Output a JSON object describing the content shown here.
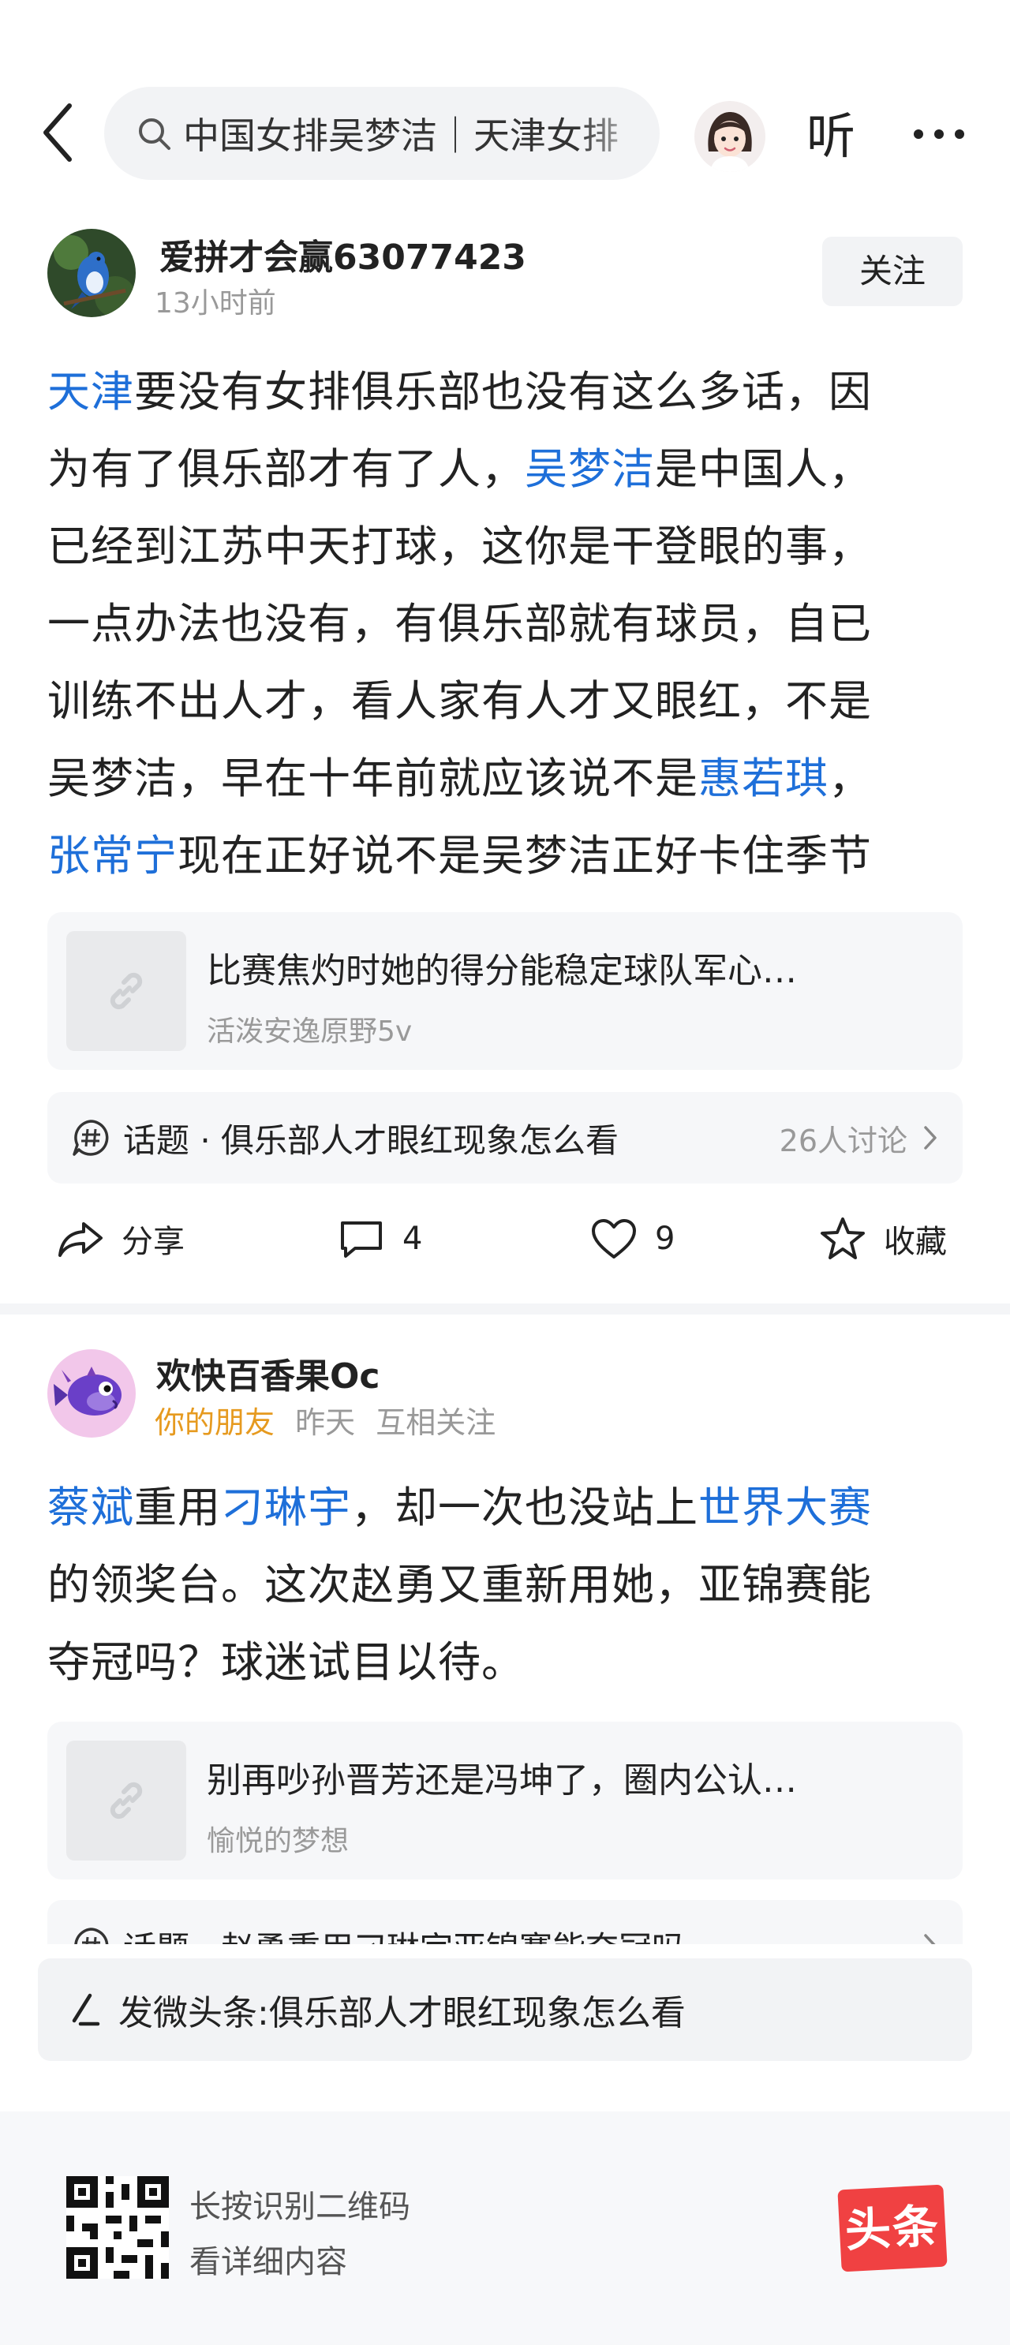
{
  "header": {
    "search_text": "中国女排吴梦洁｜天津女排",
    "listen_label": "听"
  },
  "post1": {
    "author": "爱拼才会赢63077423",
    "time": "13小时前",
    "follow_label": "关注",
    "body_lines": [
      [
        {
          "t": "天津",
          "hl": true
        },
        {
          "t": "要没有女排俱乐部也没有这么多话，因"
        }
      ],
      [
        {
          "t": "为有了俱乐部才有了人，"
        },
        {
          "t": "吴梦洁",
          "hl": true
        },
        {
          "t": "是中国人，"
        }
      ],
      [
        {
          "t": "已经到江苏中天打球，这你是干登眼的事，"
        }
      ],
      [
        {
          "t": "一点办法也没有，有俱乐部就有球员，自已"
        }
      ],
      [
        {
          "t": "训练不出人才，看人家有人才又眼红，不是"
        }
      ],
      [
        {
          "t": "吴梦洁，早在十年前就应该说不是"
        },
        {
          "t": "惠若琪",
          "hl": true
        },
        {
          "t": "，"
        }
      ],
      [
        {
          "t": "张常宁",
          "hl": true
        },
        {
          "t": "现在正好说不是吴梦洁正好卡住季节"
        }
      ]
    ],
    "link_card": {
      "title": "比赛焦灼时她的得分能稳定球队军心…",
      "source": "活泼安逸原野5v"
    },
    "topic": {
      "label": "话题 · 俱乐部人才眼红现象怎么看",
      "count": "26人讨论"
    },
    "actions": {
      "share": "分享",
      "comments": "4",
      "likes": "9",
      "collect": "收藏"
    }
  },
  "post2": {
    "author": "欢快百香果Oc",
    "friend_tag": "你的朋友",
    "time": "昨天",
    "relation": "互相关注",
    "body_lines": [
      [
        {
          "t": "蔡斌",
          "hl": true
        },
        {
          "t": "重用"
        },
        {
          "t": "刁琳宇",
          "hl": true
        },
        {
          "t": "，却一次也没站上"
        },
        {
          "t": "世界大赛",
          "hl": true
        }
      ],
      [
        {
          "t": "的领奖台。这次赵勇又重新用她，亚锦赛能"
        }
      ],
      [
        {
          "t": "夺冠吗？球迷试目以待。"
        }
      ]
    ],
    "link_card": {
      "title": "别再吵孙晋芳还是冯坤了，圈内公认…",
      "source": "愉悦的梦想"
    },
    "topic": {
      "label": "话题 · 赵勇重用刁琳宇亚锦赛能夺冠吗"
    }
  },
  "post_prompt": "发微头条:俱乐部人才眼红现象怎么看",
  "footer": {
    "line1": "长按识别二维码",
    "line2": "看详细内容",
    "logo_text": "头条"
  },
  "colors": {
    "link_blue": "#1e6fd9",
    "friend_orange": "#e69a1f",
    "logo_red": "#f04142"
  }
}
